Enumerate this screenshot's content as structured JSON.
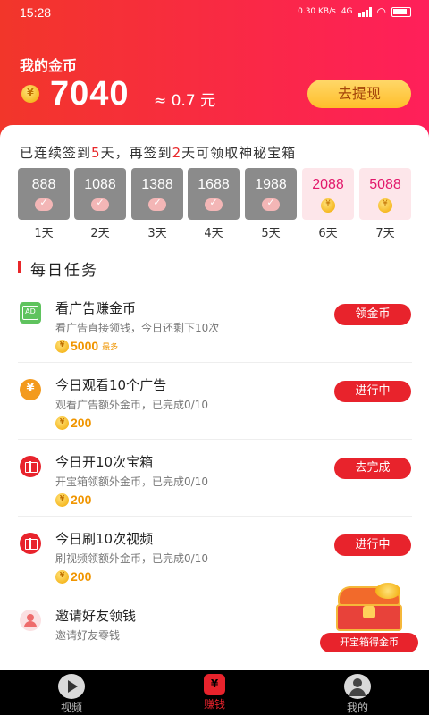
{
  "status_bar": {
    "time": "15:28",
    "speed": "0.30 KB/s",
    "network": "4G"
  },
  "header": {
    "title": "我的金币",
    "balance": "7040",
    "approx": "≈ 0.7 元",
    "withdraw_label": "去提现"
  },
  "checkin": {
    "prefix": "已连续签到",
    "streak": "5",
    "mid": "天，再签到",
    "remaining": "2",
    "suffix": "天可领取神秘宝箱",
    "days": [
      {
        "value": "888",
        "label": "1天",
        "state": "done"
      },
      {
        "value": "1088",
        "label": "2天",
        "state": "done"
      },
      {
        "value": "1388",
        "label": "3天",
        "state": "done"
      },
      {
        "value": "1688",
        "label": "4天",
        "state": "done"
      },
      {
        "value": "1988",
        "label": "5天",
        "state": "done"
      },
      {
        "value": "2088",
        "label": "6天",
        "state": "future"
      },
      {
        "value": "5088",
        "label": "7天",
        "state": "future"
      }
    ]
  },
  "tasks_section": {
    "title": "每日任务"
  },
  "tasks": [
    {
      "icon": "ad-icon",
      "title": "看广告赚金币",
      "desc": "看广告直接领钱，今日还剩下10次",
      "reward": "5000",
      "reward_note": "最多",
      "button": "领金币"
    },
    {
      "icon": "yen-icon",
      "title": "今日观看10个广告",
      "desc": "观看广告额外金币，已完成0/10",
      "reward": "200",
      "reward_note": "",
      "button": "进行中"
    },
    {
      "icon": "gift-icon",
      "title": "今日开10次宝箱",
      "desc": "开宝箱领额外金币，已完成0/10",
      "reward": "200",
      "reward_note": "",
      "button": "去完成"
    },
    {
      "icon": "gift-icon",
      "title": "今日刷10次视频",
      "desc": "刷视频领额外金币，已完成0/10",
      "reward": "200",
      "reward_note": "",
      "button": "进行中"
    },
    {
      "icon": "friends-icon",
      "title": "邀请好友领钱",
      "desc": "邀请好友零钱",
      "reward": "",
      "reward_note": "",
      "button": ""
    }
  ],
  "treasure": {
    "label": "开宝箱得金币"
  },
  "nav": [
    {
      "label": "视频",
      "icon": "play-icon",
      "active": false
    },
    {
      "label": "赚钱",
      "icon": "earn-icon",
      "active": true
    },
    {
      "label": "我的",
      "icon": "user-icon",
      "active": false
    }
  ],
  "colors": {
    "primary": "#e8232c",
    "gold": "#f09500",
    "header_start": "#f2362a",
    "header_end": "#ff1f5a"
  }
}
